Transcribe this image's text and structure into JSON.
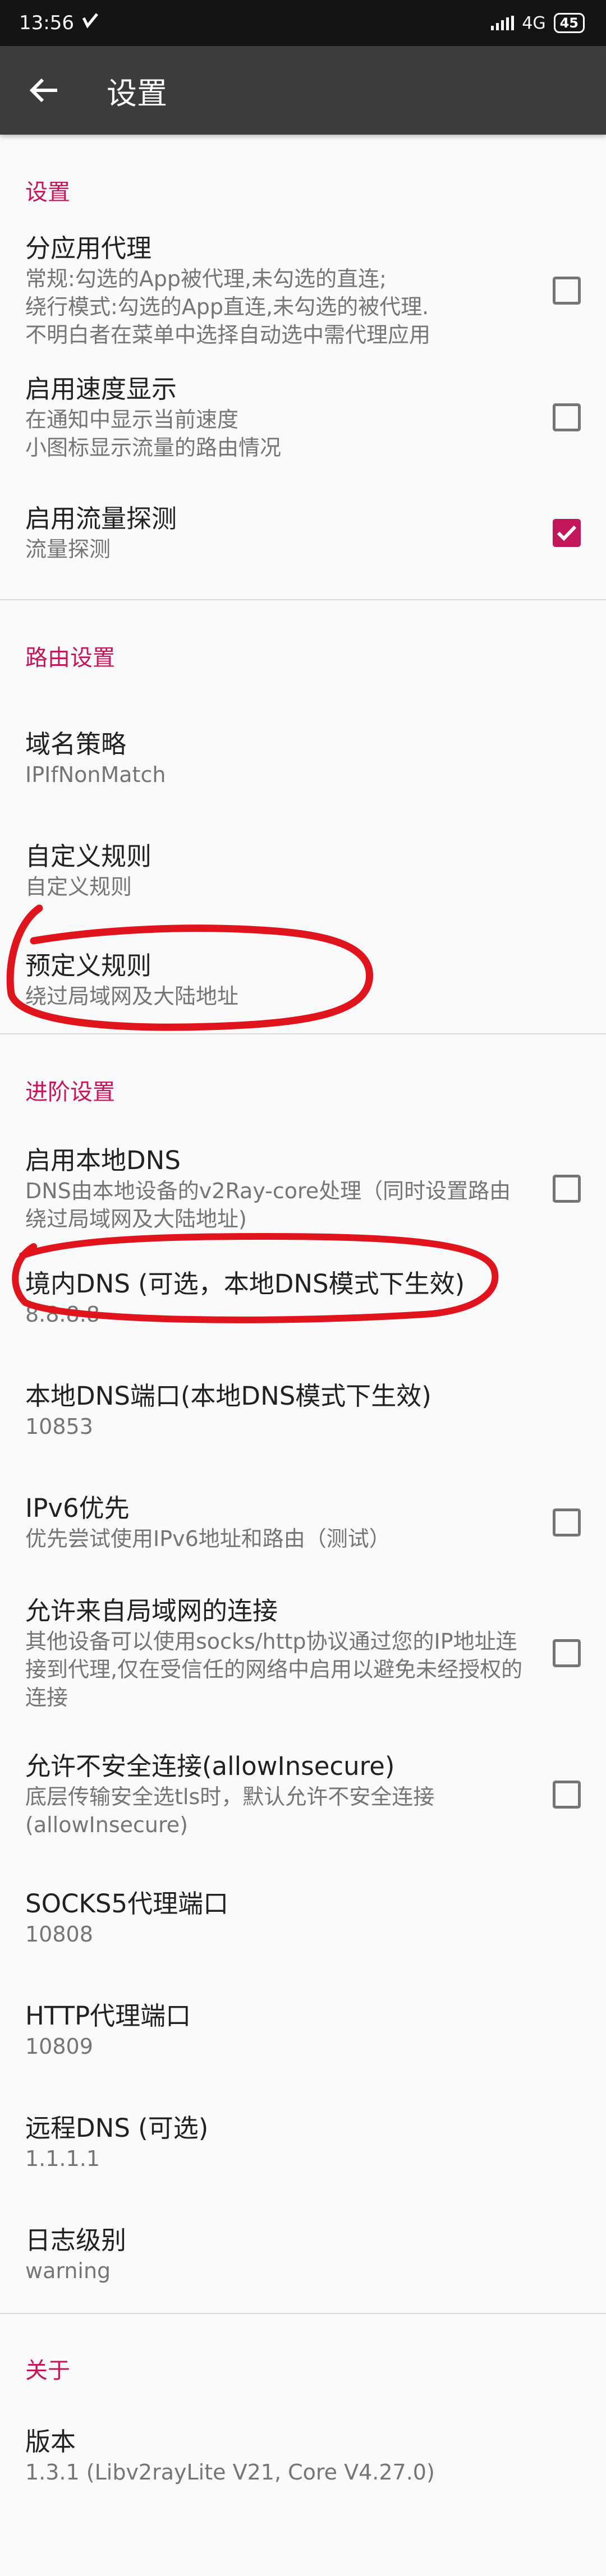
{
  "status_bar": {
    "time": "13:56",
    "network": "4G",
    "battery": "45"
  },
  "app_bar": {
    "title": "设置"
  },
  "colors": {
    "accent": "#c2185b",
    "app_bar": "#3c3c3c",
    "annotation": "#e0141c"
  },
  "sections": {
    "settings": {
      "header": "设置",
      "per_app_proxy": {
        "title": "分应用代理",
        "summary": "常规:勾选的App被代理,未勾选的直连;\n绕行模式:勾选的App直连,未勾选的被代理.\n不明白者在菜单中选择自动选中需代理应用",
        "checked": false
      },
      "speed_display": {
        "title": "启用速度显示",
        "summary": "在通知中显示当前速度\n小图标显示流量的路由情况",
        "checked": false
      },
      "traffic_sniffing": {
        "title": "启用流量探测",
        "summary": "流量探测",
        "checked": true
      }
    },
    "routing": {
      "header": "路由设置",
      "domain_strategy": {
        "title": "域名策略",
        "summary": "IPIfNonMatch"
      },
      "custom_rules": {
        "title": "自定义规则",
        "summary": "自定义规则"
      },
      "predefined_rules": {
        "title": "预定义规则",
        "summary": "绕过局域网及大陆地址"
      }
    },
    "advanced": {
      "header": "进阶设置",
      "local_dns": {
        "title": "启用本地DNS",
        "summary": "DNS由本地设备的v2Ray-core处理（同时设置路由绕过局域网及大陆地址)",
        "checked": false
      },
      "domestic_dns": {
        "title": "境内DNS (可选，本地DNS模式下生效)",
        "summary": "8.8.8.8"
      },
      "local_dns_port": {
        "title": "本地DNS端口(本地DNS模式下生效)",
        "summary": "10853"
      },
      "ipv6": {
        "title": "IPv6优先",
        "summary": "优先尝试使用IPv6地址和路由（测试）",
        "checked": false
      },
      "allow_lan": {
        "title": "允许来自局域网的连接",
        "summary": "其他设备可以使用socks/http协议通过您的IP地址连接到代理,仅在受信任的网络中启用以避免未经授权的连接",
        "checked": false
      },
      "allow_insecure": {
        "title": "允许不安全连接(allowInsecure)",
        "summary": "底层传输安全选tls时，默认允许不安全连接(allowInsecure)",
        "checked": false
      },
      "socks_port": {
        "title": "SOCKS5代理端口",
        "summary": "10808"
      },
      "http_port": {
        "title": "HTTP代理端口",
        "summary": "10809"
      },
      "remote_dns": {
        "title": "远程DNS (可选)",
        "summary": "1.1.1.1"
      },
      "log_level": {
        "title": "日志级别",
        "summary": "warning"
      }
    },
    "about": {
      "header": "关于",
      "version": {
        "title": "版本",
        "summary": "1.3.1 (Libv2rayLite V21, Core V4.27.0)"
      }
    }
  }
}
